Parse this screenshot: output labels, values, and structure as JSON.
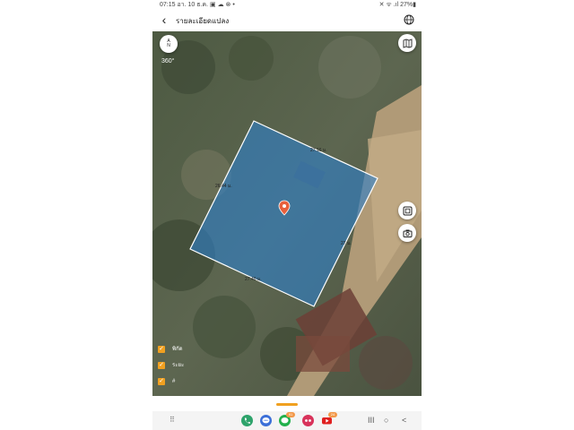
{
  "status_bar": {
    "time_date": "07:15  อา. 10 ธ.ค.",
    "notification_icons": "▣ ☁ ⊗ •",
    "right_indicators": "✕ ᯤ .ıl 27%▮"
  },
  "header": {
    "back_icon": "‹",
    "title": "รายละเอียดแปลง"
  },
  "map": {
    "compass_letters": "A\nN",
    "compass_top": "A",
    "compass_bottom": "N",
    "view_label": "360°",
    "parcel_fill_color": "#2f80c8",
    "measurements": {
      "top": "27.16 ม.",
      "left": "26.44 ม.",
      "right": "27 ม.",
      "bottom": "27.40 ม."
    }
  },
  "legend": {
    "items": [
      {
        "label": "พิกัด",
        "checked": true
      },
      {
        "label": "ระยะ",
        "checked": true
      },
      {
        "label": "#",
        "checked": true
      }
    ]
  },
  "dock": {
    "badges": {
      "messages": "",
      "line": "91",
      "youtube": "24"
    }
  },
  "nav": {
    "recents": "III",
    "home": "○",
    "back": "<"
  },
  "colors": {
    "accent": "#f0a020",
    "parcel_border": "#ffffff",
    "pin": "#e8603c"
  }
}
